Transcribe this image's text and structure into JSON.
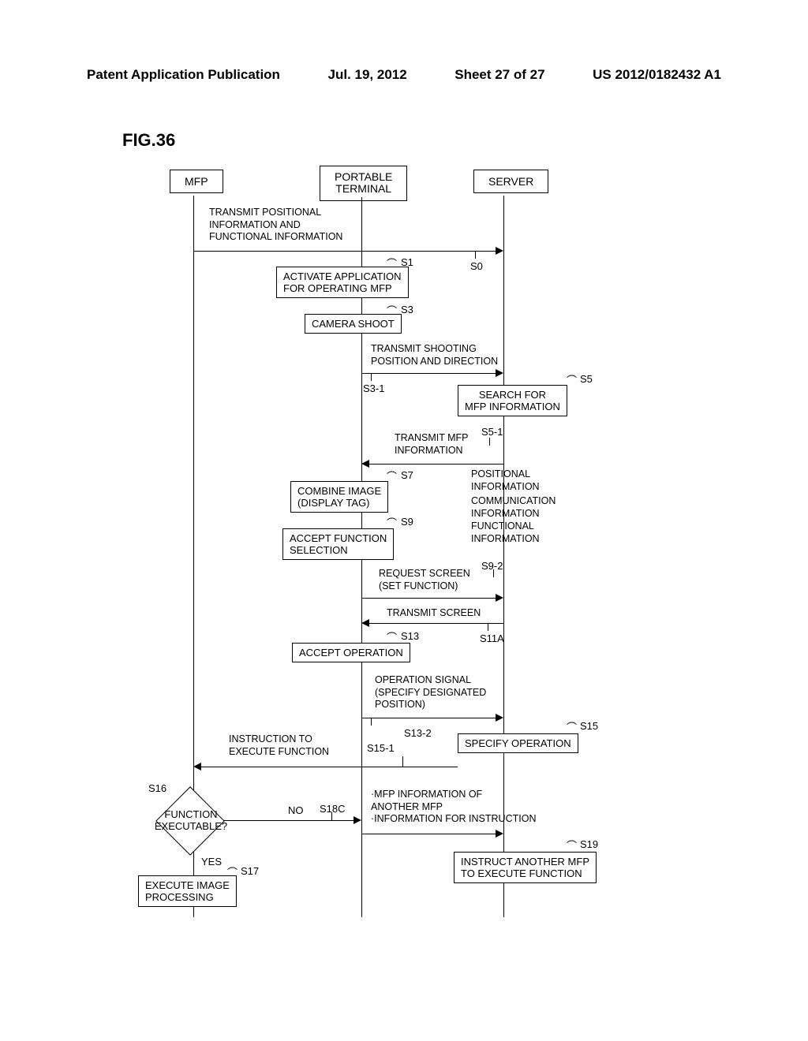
{
  "header": {
    "left": "Patent Application Publication",
    "date": "Jul. 19, 2012",
    "sheet": "Sheet 27 of 27",
    "pubno": "US 2012/0182432 A1"
  },
  "figure_label": "FIG.36",
  "columns": {
    "mfp": "MFP",
    "portable": "PORTABLE\nTERMINAL",
    "server": "SERVER"
  },
  "labels": {
    "transmit_pos": "TRANSMIT POSITIONAL\nINFORMATION AND\nFUNCTIONAL INFORMATION",
    "s0": "S0",
    "s1": "S1",
    "activate_app": "ACTIVATE APPLICATION\nFOR OPERATING MFP",
    "s3": "S3",
    "camera_shoot": "CAMERA SHOOT",
    "transmit_shoot": "TRANSMIT SHOOTING\nPOSITION AND DIRECTION",
    "s3_1": "S3-1",
    "s5": "S5",
    "search_mfp": "SEARCH FOR\nMFP INFORMATION",
    "s5_1": "S5-1",
    "transmit_mfp": "TRANSMIT MFP\nINFORMATION",
    "positional_info": "POSITIONAL\nINFORMATION",
    "comm_info": "COMMUNICATION\nINFORMATION",
    "func_info": "FUNCTIONAL\nINFORMATION",
    "s7": "S7",
    "combine": "COMBINE IMAGE\n(DISPLAY TAG)",
    "s9": "S9",
    "accept_func": "ACCEPT FUNCTION\nSELECTION",
    "s9_2": "S9-2",
    "request_screen": "REQUEST SCREEN\n(SET FUNCTION)",
    "transmit_screen": "TRANSMIT SCREEN",
    "s11a": "S11A",
    "s13": "S13",
    "accept_op": "ACCEPT OPERATION",
    "op_signal": "OPERATION SIGNAL\n(SPECIFY DESIGNATED\nPOSITION)",
    "s13_2": "S13-2",
    "s15": "S15",
    "s15_1": "S15-1",
    "specify_op": "SPECIFY OPERATION",
    "instruction_exec": "INSTRUCTION TO\nEXECUTE FUNCTION",
    "s16": "S16",
    "function_exec": "FUNCTION\nEXECUTABLE?",
    "yes": "YES",
    "no": "NO",
    "s18c": "S18C",
    "mfp_info_another": "·MFP INFORMATION OF\nANOTHER MFP\n·INFORMATION FOR INSTRUCTION",
    "s19": "S19",
    "instruct_another": "INSTRUCT ANOTHER MFP\nTO EXECUTE FUNCTION",
    "s17": "S17",
    "execute_image": "EXECUTE IMAGE\nPROCESSING"
  }
}
